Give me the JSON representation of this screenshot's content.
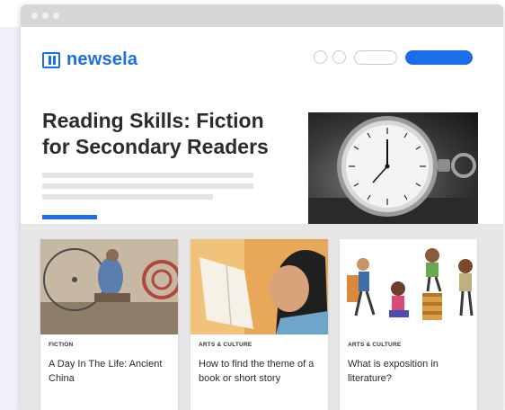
{
  "brand": {
    "name": "newsela",
    "color": "#1b6ee8"
  },
  "hero": {
    "title": "Reading Skills: Fiction for Secondary Readers",
    "image": "pocket-watch-photo"
  },
  "cards": [
    {
      "category": "FICTION",
      "title": "A Day In The Life: Ancient China",
      "image": "spinning-wheel-photo"
    },
    {
      "category": "ARTS & CULTURE",
      "title": "How to find the theme of a book or short story",
      "image": "child-reading-photo"
    },
    {
      "category": "ARTS & CULTURE",
      "title": "What is exposition in literature?",
      "image": "kids-with-books-illustration"
    }
  ]
}
